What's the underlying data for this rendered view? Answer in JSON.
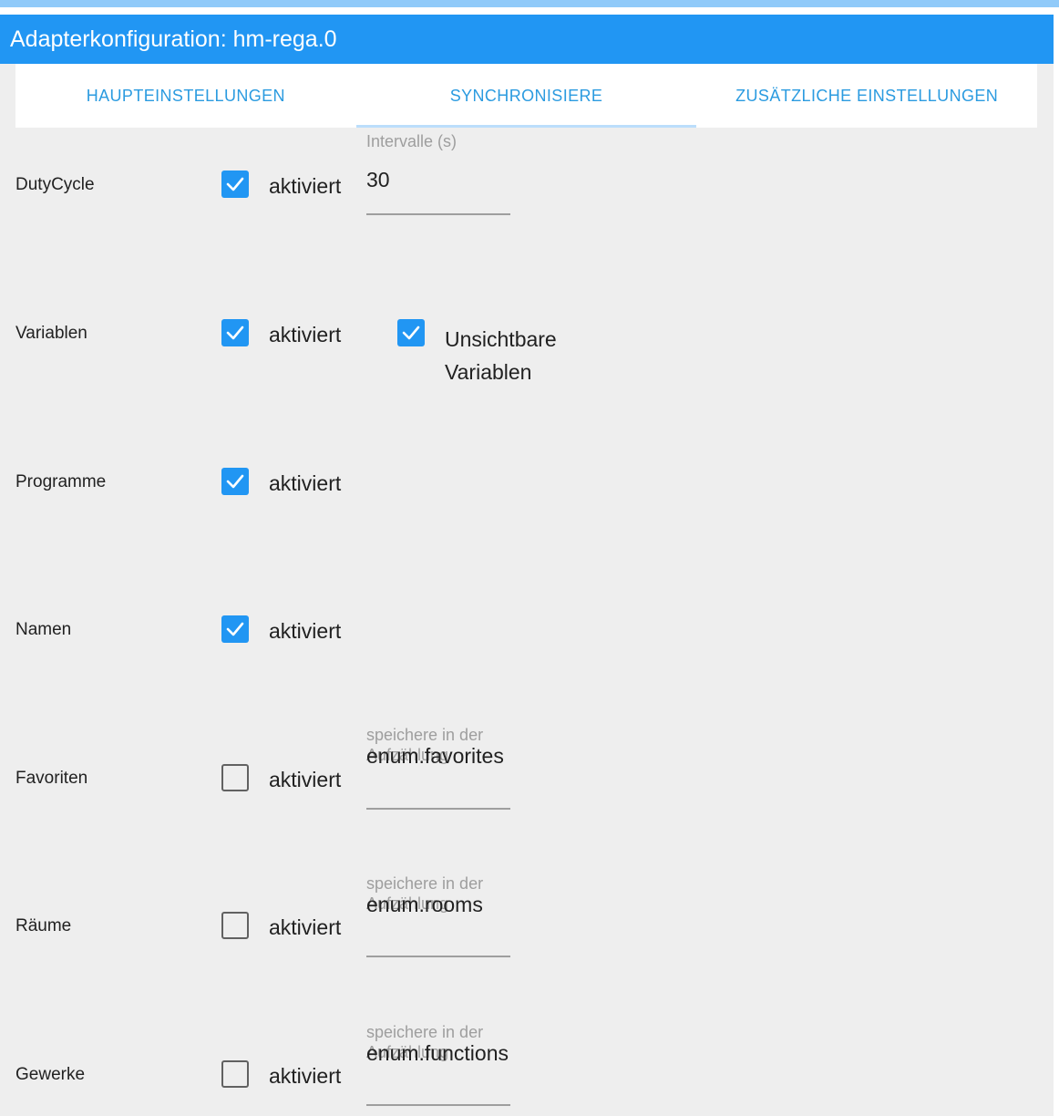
{
  "title": "Adapterkonfiguration: hm-rega.0",
  "tabs": [
    {
      "label": "HAUPTEINSTELLUNGEN"
    },
    {
      "label": "SYNCHRONISIERE"
    },
    {
      "label": "ZUSÄTZLICHE EINSTELLUNGEN"
    }
  ],
  "active_tab": "SYNCHRONISIERE",
  "colors": {
    "accent": "#2196f3",
    "tab_text": "#2b9be0",
    "background": "#eeeeee",
    "muted": "#9e9e9e"
  },
  "rows": {
    "dutycycle": {
      "label": "DutyCycle",
      "checkbox_label": "aktiviert",
      "checked": true,
      "field_label": "Intervalle (s)",
      "field_value": "30"
    },
    "variablen": {
      "label": "Variablen",
      "checkbox_label": "aktiviert",
      "checked": true,
      "secondary_label": "Unsichtbare Variablen",
      "secondary_checked": true
    },
    "programme": {
      "label": "Programme",
      "checkbox_label": "aktiviert",
      "checked": true
    },
    "namen": {
      "label": "Namen",
      "checkbox_label": "aktiviert",
      "checked": true
    },
    "favoriten": {
      "label": "Favoriten",
      "checkbox_label": "aktiviert",
      "checked": false,
      "field_label": "speichere in der Aufzählung",
      "field_value": "enum.favorites"
    },
    "raeume": {
      "label": "Räume",
      "checkbox_label": "aktiviert",
      "checked": false,
      "field_label": "speichere in der Aufzählung",
      "field_value": "enum.rooms"
    },
    "gewerke": {
      "label": "Gewerke",
      "checkbox_label": "aktiviert",
      "checked": false,
      "field_label": "speichere in der Aufzählung",
      "field_value": "enum.functions"
    }
  }
}
